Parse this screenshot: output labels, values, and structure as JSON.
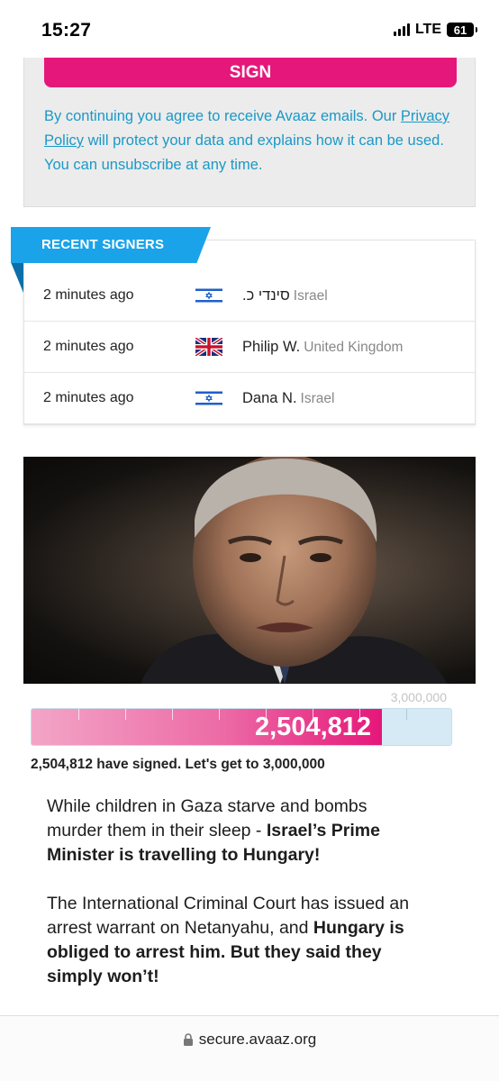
{
  "status_bar": {
    "time": "15:27",
    "network": "LTE",
    "battery": "61"
  },
  "sign_box": {
    "button_label": "SIGN",
    "consent_before": "By continuing you agree to receive Avaaz emails. Our ",
    "privacy_link": "Privacy Policy",
    "consent_after": " will protect your data and explains how it can be used. You can unsubscribe at any time."
  },
  "recent_signers": {
    "title": "RECENT SIGNERS",
    "rows": [
      {
        "time": "2 minutes ago",
        "flag": "israel-flag-icon",
        "name": "סינדי כ.",
        "country": "Israel"
      },
      {
        "time": "2 minutes ago",
        "flag": "uk-flag-icon",
        "name": "Philip W.",
        "country": "United Kingdom"
      },
      {
        "time": "2 minutes ago",
        "flag": "israel-flag-icon",
        "name": "Dana N.",
        "country": "Israel"
      }
    ]
  },
  "progress": {
    "goal_label": "3,000,000",
    "count_label": "2,504,812",
    "signed_text": "2,504,812 have signed. Let's get to 3,000,000",
    "fraction": 0.835
  },
  "body": {
    "p1_text": "While children in Gaza starve and bombs murder them in their sleep - ",
    "p1_bold": "Israel’s Prime Minister is travelling to Hungary!",
    "p2_text": "The International Criminal Court has issued an arrest warrant on Netanyahu, and ",
    "p2_bold": "Hungary is obliged to arrest him. But they said they simply won’t!"
  },
  "url_bar": {
    "url": "secure.avaaz.org"
  },
  "colors": {
    "brand_pink": "#e5177a",
    "link_blue": "#1a99c6",
    "tab_blue": "#1aa3e8"
  }
}
